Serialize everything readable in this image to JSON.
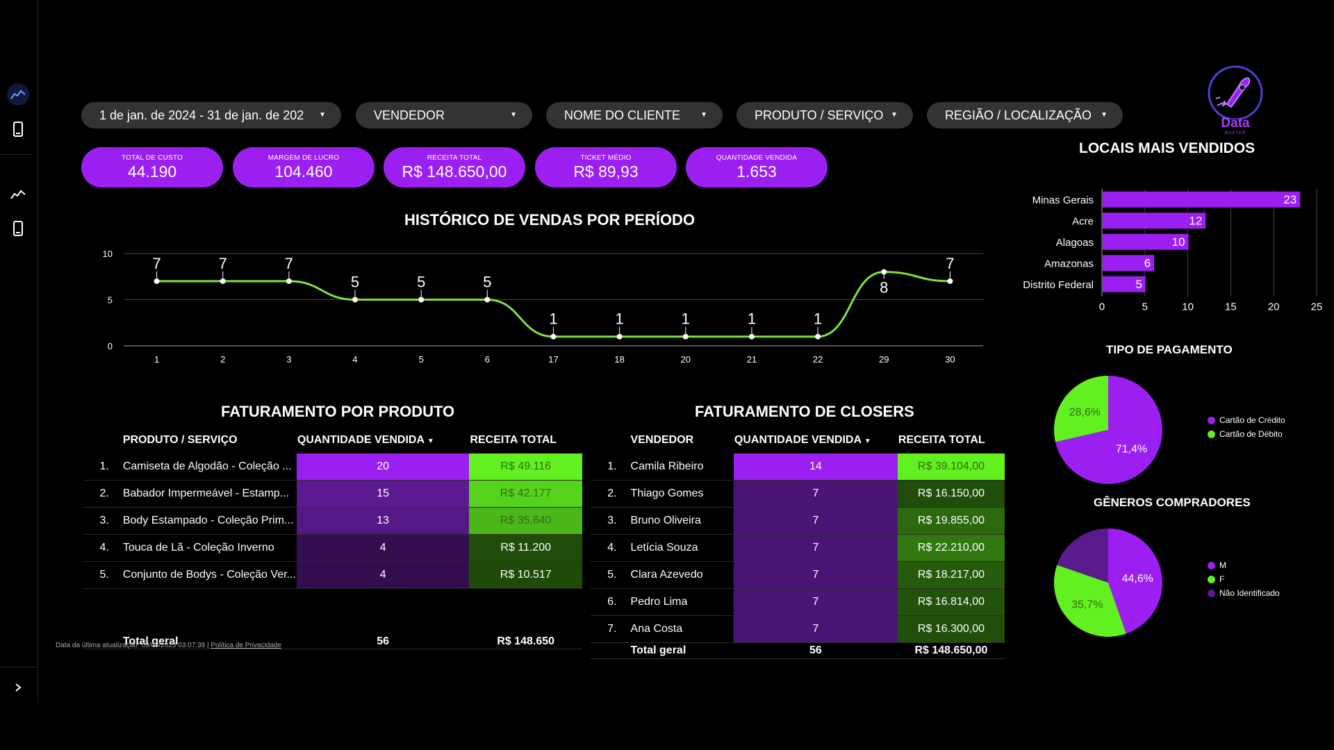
{
  "sidebar": {
    "icons": [
      "dashboard-line-icon",
      "mobile-device-icon",
      "trend-line-icon",
      "mobile-device-icon-2"
    ],
    "expand_icon": "chevron-right-icon"
  },
  "filters": [
    {
      "label": "1 de jan. de 2024 - 31 de jan. de 202"
    },
    {
      "label": "VENDEDOR"
    },
    {
      "label": "NOME DO CLIENTE"
    },
    {
      "label": "PRODUTO / SERVIÇO"
    },
    {
      "label": "REGIÃO / LOCALIZAÇÃO"
    }
  ],
  "kpis": [
    {
      "label": "TOTAL DE CUSTO",
      "value": "44.190"
    },
    {
      "label": "MARGEM DE LUCRO",
      "value": "104.460"
    },
    {
      "label": "RECEITA TOTAL",
      "value": "R$ 148.650,00"
    },
    {
      "label": "TICKET MÉDIO",
      "value": "R$ 89,93"
    },
    {
      "label": "QUANTIDADE VENDIDA",
      "value": "1.653"
    }
  ],
  "logo": {
    "text": "Data",
    "subtext": "MASTER"
  },
  "colors": {
    "purple": "#9b1ff0",
    "green": "#63f021",
    "line_green": "#7ee23d",
    "dark_purple": "#5b1a8e"
  },
  "chart_data": [
    {
      "type": "line",
      "title": "HISTÓRICO DE VENDAS POR PERÍODO",
      "categories": [
        "1",
        "2",
        "3",
        "4",
        "5",
        "6",
        "17",
        "18",
        "20",
        "21",
        "22",
        "29",
        "30"
      ],
      "values": [
        7,
        7,
        7,
        5,
        5,
        5,
        1,
        1,
        1,
        1,
        1,
        8,
        7
      ],
      "ylim": [
        0,
        10
      ],
      "yticks": [
        "0",
        "5",
        "10"
      ],
      "grid": true
    },
    {
      "type": "bar",
      "orientation": "horizontal",
      "title": "LOCAIS MAIS VENDIDOS",
      "categories": [
        "Minas Gerais",
        "Acre",
        "Alagoas",
        "Amazonas",
        "Distrito Federal"
      ],
      "values": [
        23,
        12,
        10,
        6,
        5
      ],
      "xlim": [
        0,
        25
      ],
      "xticks": [
        "0",
        "5",
        "10",
        "15",
        "20",
        "25"
      ]
    },
    {
      "type": "pie",
      "title": "TIPO DE PAGAMENTO",
      "labels": [
        "Cartão de Crédito",
        "Cartão de Débito"
      ],
      "values": [
        71.4,
        28.6
      ],
      "value_labels": [
        "71,4%",
        "28,6%"
      ],
      "legend": "right"
    },
    {
      "type": "pie",
      "title": "GÊNEROS COMPRADORES",
      "labels": [
        "M",
        "F",
        "Não Identificado"
      ],
      "values": [
        44.6,
        35.7,
        19.7
      ],
      "value_labels": [
        "44,6%",
        "35,7%",
        ""
      ],
      "legend": "right"
    }
  ],
  "produto_table": {
    "title": "FATURAMENTO POR PRODUTO",
    "headers": [
      "PRODUTO / SERVIÇO",
      "QUANTIDADE VENDIDA",
      "RECEITA TOTAL"
    ],
    "sort_icon": "sort-desc-icon",
    "rows": [
      {
        "idx": "1.",
        "name": "Camiseta de Algodão - Coleção ...",
        "qty": "20",
        "rev": "R$ 49.116"
      },
      {
        "idx": "2.",
        "name": "Babador Impermeável - Estamp...",
        "qty": "15",
        "rev": "R$ 42.177"
      },
      {
        "idx": "3.",
        "name": "Body Estampado - Coleção Prim...",
        "qty": "13",
        "rev": "R$ 35.640"
      },
      {
        "idx": "4.",
        "name": "Touca de Lã - Coleção Inverno",
        "qty": "4",
        "rev": "R$ 11.200"
      },
      {
        "idx": "5.",
        "name": "Conjunto de Bodys - Coleção Ver...",
        "qty": "4",
        "rev": "R$ 10.517"
      }
    ],
    "total": {
      "label": "Total geral",
      "qty": "56",
      "rev": "R$ 148.650"
    }
  },
  "closers_table": {
    "title": "FATURAMENTO DE CLOSERS",
    "headers": [
      "VENDEDOR",
      "QUANTIDADE VENDIDA",
      "RECEITA TOTAL"
    ],
    "sort_icon": "sort-desc-icon",
    "rows": [
      {
        "idx": "1.",
        "name": "Camila Ribeiro",
        "qty": "14",
        "rev": "R$ 39.104,00"
      },
      {
        "idx": "2.",
        "name": "Thiago Gomes",
        "qty": "7",
        "rev": "R$ 16.150,00"
      },
      {
        "idx": "3.",
        "name": "Bruno Oliveira",
        "qty": "7",
        "rev": "R$ 19.855,00"
      },
      {
        "idx": "4.",
        "name": "Letícia Souza",
        "qty": "7",
        "rev": "R$ 22.210,00"
      },
      {
        "idx": "5.",
        "name": "Clara Azevedo",
        "qty": "7",
        "rev": "R$ 18.217,00"
      },
      {
        "idx": "6.",
        "name": "Pedro Lima",
        "qty": "7",
        "rev": "R$ 16.814,00"
      },
      {
        "idx": "7.",
        "name": "Ana Costa",
        "qty": "7",
        "rev": "R$ 16.300,00"
      }
    ],
    "total": {
      "label": "Total geral",
      "qty": "56",
      "rev": "R$ 148.650,00"
    }
  },
  "footer": {
    "updated": "Data da última atualização: 09/03/2025 03:07:39",
    "separator": "|",
    "privacy": "Política de Privacidade"
  }
}
